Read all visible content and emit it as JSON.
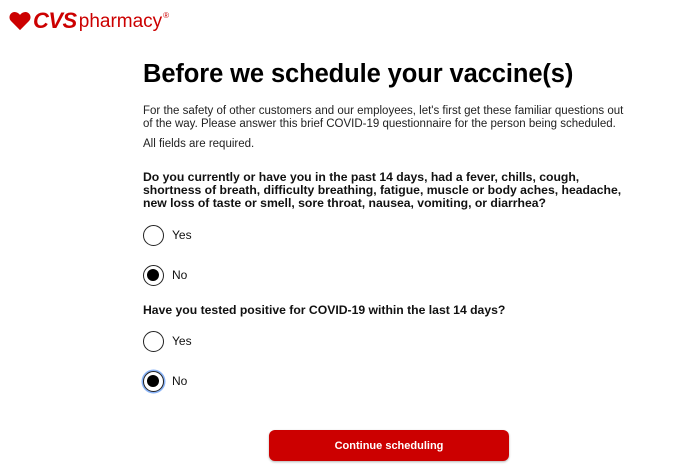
{
  "header": {
    "logo_cvs": "CVS",
    "logo_pharmacy": "pharmacy",
    "logo_reg": "®",
    "brand_color": "#cc0000"
  },
  "main": {
    "title": "Before we schedule your vaccine(s)",
    "intro": "For the safety of other customers and our employees, let's first get these familiar questions out of the way. Please answer this brief COVID-19 questionnaire for the person being scheduled.",
    "required_note": "All fields are required."
  },
  "questions": [
    {
      "text": "Do you currently or have you in the past 14 days, had a fever, chills, cough, shortness of breath, difficulty breathing, fatigue, muscle or body aches, headache, new loss of taste or smell, sore throat, nausea, vomiting, or diarrhea?",
      "options": [
        {
          "label": "Yes",
          "selected": false
        },
        {
          "label": "No",
          "selected": true
        }
      ]
    },
    {
      "text": "Have you tested positive for COVID-19 within the last 14 days?",
      "options": [
        {
          "label": "Yes",
          "selected": false
        },
        {
          "label": "No",
          "selected": true
        }
      ]
    }
  ],
  "actions": {
    "continue_label": "Continue scheduling"
  }
}
